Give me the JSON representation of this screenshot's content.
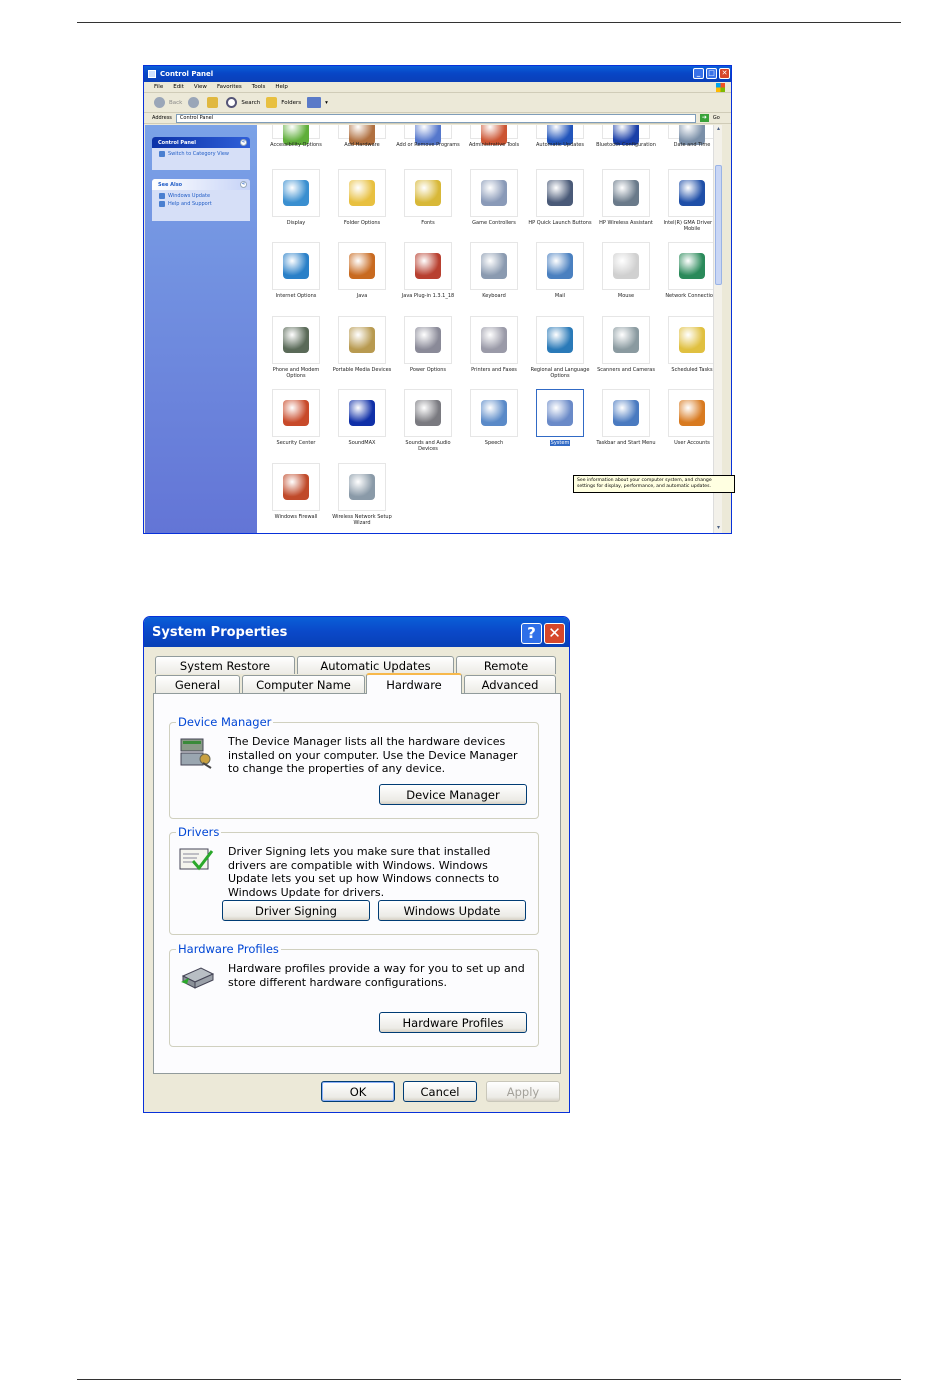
{
  "control_panel": {
    "title": "Control Panel",
    "menu": [
      "File",
      "Edit",
      "View",
      "Favorites",
      "Tools",
      "Help"
    ],
    "toolbar": {
      "back": "Back",
      "search": "Search",
      "folders": "Folders"
    },
    "address": {
      "label": "Address",
      "value": "Control Panel",
      "go": "Go"
    },
    "sidebar": {
      "control_panel_header": "Control Panel",
      "switch_link": "Switch to Category View",
      "see_also_header": "See Also",
      "see_also_items": [
        "Windows Update",
        "Help and Support"
      ]
    },
    "icons": [
      {
        "label": "Accessibility Options",
        "color": "#5fae3a"
      },
      {
        "label": "Add Hardware",
        "color": "#b07040"
      },
      {
        "label": "Add or Remove Programs",
        "color": "#5577cc"
      },
      {
        "label": "Administrative Tools",
        "color": "#cc5533"
      },
      {
        "label": "Automatic Updates",
        "color": "#2255bb"
      },
      {
        "label": "Bluetooth Configuration",
        "color": "#1a3fa8"
      },
      {
        "label": "Date and Time",
        "color": "#7a8fa8"
      },
      {
        "label": "Display",
        "color": "#3a8fd0"
      },
      {
        "label": "Folder Options",
        "color": "#e8c040"
      },
      {
        "label": "Fonts",
        "color": "#d8b838"
      },
      {
        "label": "Game Controllers",
        "color": "#8a9ab8"
      },
      {
        "label": "HP Quick Launch Buttons",
        "color": "#4a5a78"
      },
      {
        "label": "HP Wireless Assistant",
        "color": "#6a7a8a"
      },
      {
        "label": "Intel(R) GMA Driver for Mobile",
        "color": "#1f4fa8"
      },
      {
        "label": "Internet Options",
        "color": "#2a80c8"
      },
      {
        "label": "Java",
        "color": "#c86a20"
      },
      {
        "label": "Java Plug-in 1.3.1_18",
        "color": "#b84030"
      },
      {
        "label": "Keyboard",
        "color": "#8a9ab0"
      },
      {
        "label": "Mail",
        "color": "#4a80c0"
      },
      {
        "label": "Mouse",
        "color": "#d0d0d0"
      },
      {
        "label": "Network Connections",
        "color": "#2a8a5a"
      },
      {
        "label": "Phone and Modem Options",
        "color": "#5a6a58"
      },
      {
        "label": "Portable Media Devices",
        "color": "#b89a50"
      },
      {
        "label": "Power Options",
        "color": "#8a8a98"
      },
      {
        "label": "Printers and Faxes",
        "color": "#9a9aa8"
      },
      {
        "label": "Regional and Language Options",
        "color": "#2a7ab8"
      },
      {
        "label": "Scanners and Cameras",
        "color": "#8a9aa0"
      },
      {
        "label": "Scheduled Tasks",
        "color": "#e0c040"
      },
      {
        "label": "Security Center",
        "color": "#c84a2a"
      },
      {
        "label": "SoundMAX",
        "color": "#1030a8"
      },
      {
        "label": "Sounds and Audio Devices",
        "color": "#7a7a80"
      },
      {
        "label": "Speech",
        "color": "#5a8ac8"
      },
      {
        "label": "System",
        "color": "#6a8ac8"
      },
      {
        "label": "Taskbar and Start Menu",
        "color": "#4a7ac0"
      },
      {
        "label": "User Accounts",
        "color": "#d87a20"
      },
      {
        "label": "Windows Firewall",
        "color": "#c04a2a"
      },
      {
        "label": "Wireless Network Setup Wizard",
        "color": "#8a9aa8"
      }
    ],
    "selected_item": "System",
    "tooltip": "See information about your computer system, and change settings for display, performance, and automatic updates."
  },
  "system_properties": {
    "title": "System Properties",
    "tabs_back": [
      "System Restore",
      "Automatic Updates",
      "Remote"
    ],
    "tabs_front": [
      "General",
      "Computer Name",
      "Hardware",
      "Advanced"
    ],
    "active_tab": "Hardware",
    "device_manager": {
      "label": "Device Manager",
      "text": "The Device Manager lists all the hardware devices installed on your computer. Use the Device Manager to change the properties of any device.",
      "button": "Device Manager"
    },
    "drivers": {
      "label": "Drivers",
      "text": "Driver Signing lets you make sure that installed drivers are compatible with Windows. Windows Update lets you set up how Windows connects to Windows Update for drivers.",
      "button_signing": "Driver Signing",
      "button_update": "Windows Update"
    },
    "hardware_profiles": {
      "label": "Hardware Profiles",
      "text": "Hardware profiles provide a way for you to set up and store different hardware configurations.",
      "button": "Hardware Profiles"
    },
    "buttons": {
      "ok": "OK",
      "cancel": "Cancel",
      "apply": "Apply"
    }
  }
}
